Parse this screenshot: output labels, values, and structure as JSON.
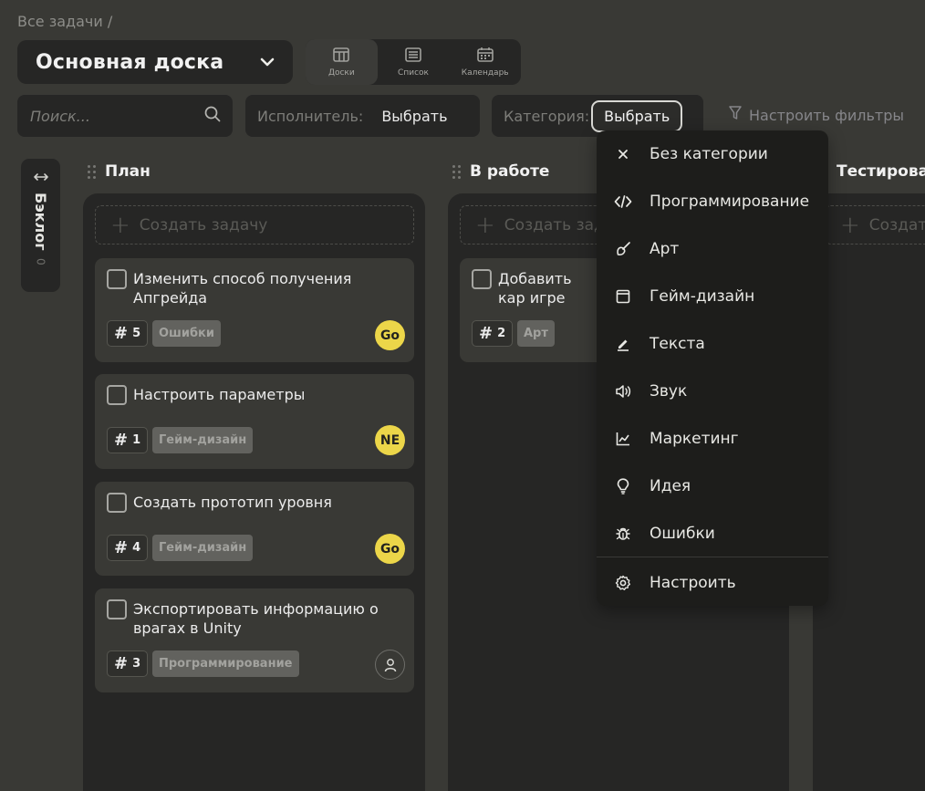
{
  "breadcrumb": "Все задачи /",
  "board": {
    "title": "Основная доска"
  },
  "views": [
    {
      "label": "Доски",
      "icon": "board-icon",
      "active": true
    },
    {
      "label": "Список",
      "icon": "list-icon",
      "active": false
    },
    {
      "label": "Календарь",
      "icon": "calendar-icon",
      "active": false
    }
  ],
  "search": {
    "placeholder": "Поиск..."
  },
  "filters": {
    "executor_label": "Исполнитель:",
    "executor_value": "Выбрать",
    "category_label": "Категория:",
    "category_value": "Выбрать",
    "custom_filters": "Настроить фильтры"
  },
  "backlog": {
    "label": "Бэклог",
    "count": "0"
  },
  "columns": [
    {
      "title": "План",
      "create_label": "Создать задачу",
      "cards": [
        {
          "title": "Изменить способ получения Апгрейда",
          "number": "5",
          "tag": "Ошибки",
          "avatar": "Go"
        },
        {
          "title": "Настроить параметры",
          "number": "1",
          "tag": "Гейм-дизайн",
          "avatar": "NE"
        },
        {
          "title": "Создать прототип уровня",
          "number": "4",
          "tag": "Гейм-дизайн",
          "avatar": "Go"
        },
        {
          "title": "Экспортировать информацию о врагах в Unity",
          "number": "3",
          "tag": "Программирование",
          "avatar": ""
        }
      ]
    },
    {
      "title": "В работе",
      "create_label": "Создать зад",
      "cards": [
        {
          "title": "Добавить кар игре",
          "number": "2",
          "tag": "Арт",
          "avatar": ""
        }
      ]
    },
    {
      "title": "Тестирова",
      "create_label": "Создат",
      "cards": []
    }
  ],
  "category_menu": {
    "items": [
      {
        "label": "Без категории",
        "icon": "close-icon"
      },
      {
        "label": "Программирование",
        "icon": "code-icon"
      },
      {
        "label": "Арт",
        "icon": "brush-icon"
      },
      {
        "label": "Гейм-дизайн",
        "icon": "window-icon"
      },
      {
        "label": "Текста",
        "icon": "pen-icon"
      },
      {
        "label": "Звук",
        "icon": "speaker-icon"
      },
      {
        "label": "Маркетинг",
        "icon": "chart-icon"
      },
      {
        "label": "Идея",
        "icon": "lightbulb-icon"
      },
      {
        "label": "Ошибки",
        "icon": "bug-icon"
      }
    ],
    "settings_label": "Настроить",
    "settings_icon": "gear-icon"
  },
  "colors": {
    "background": "#393935",
    "panel": "#262625",
    "dropdown": "#1d1d1b",
    "avatar_yellow": "#ecd649"
  }
}
